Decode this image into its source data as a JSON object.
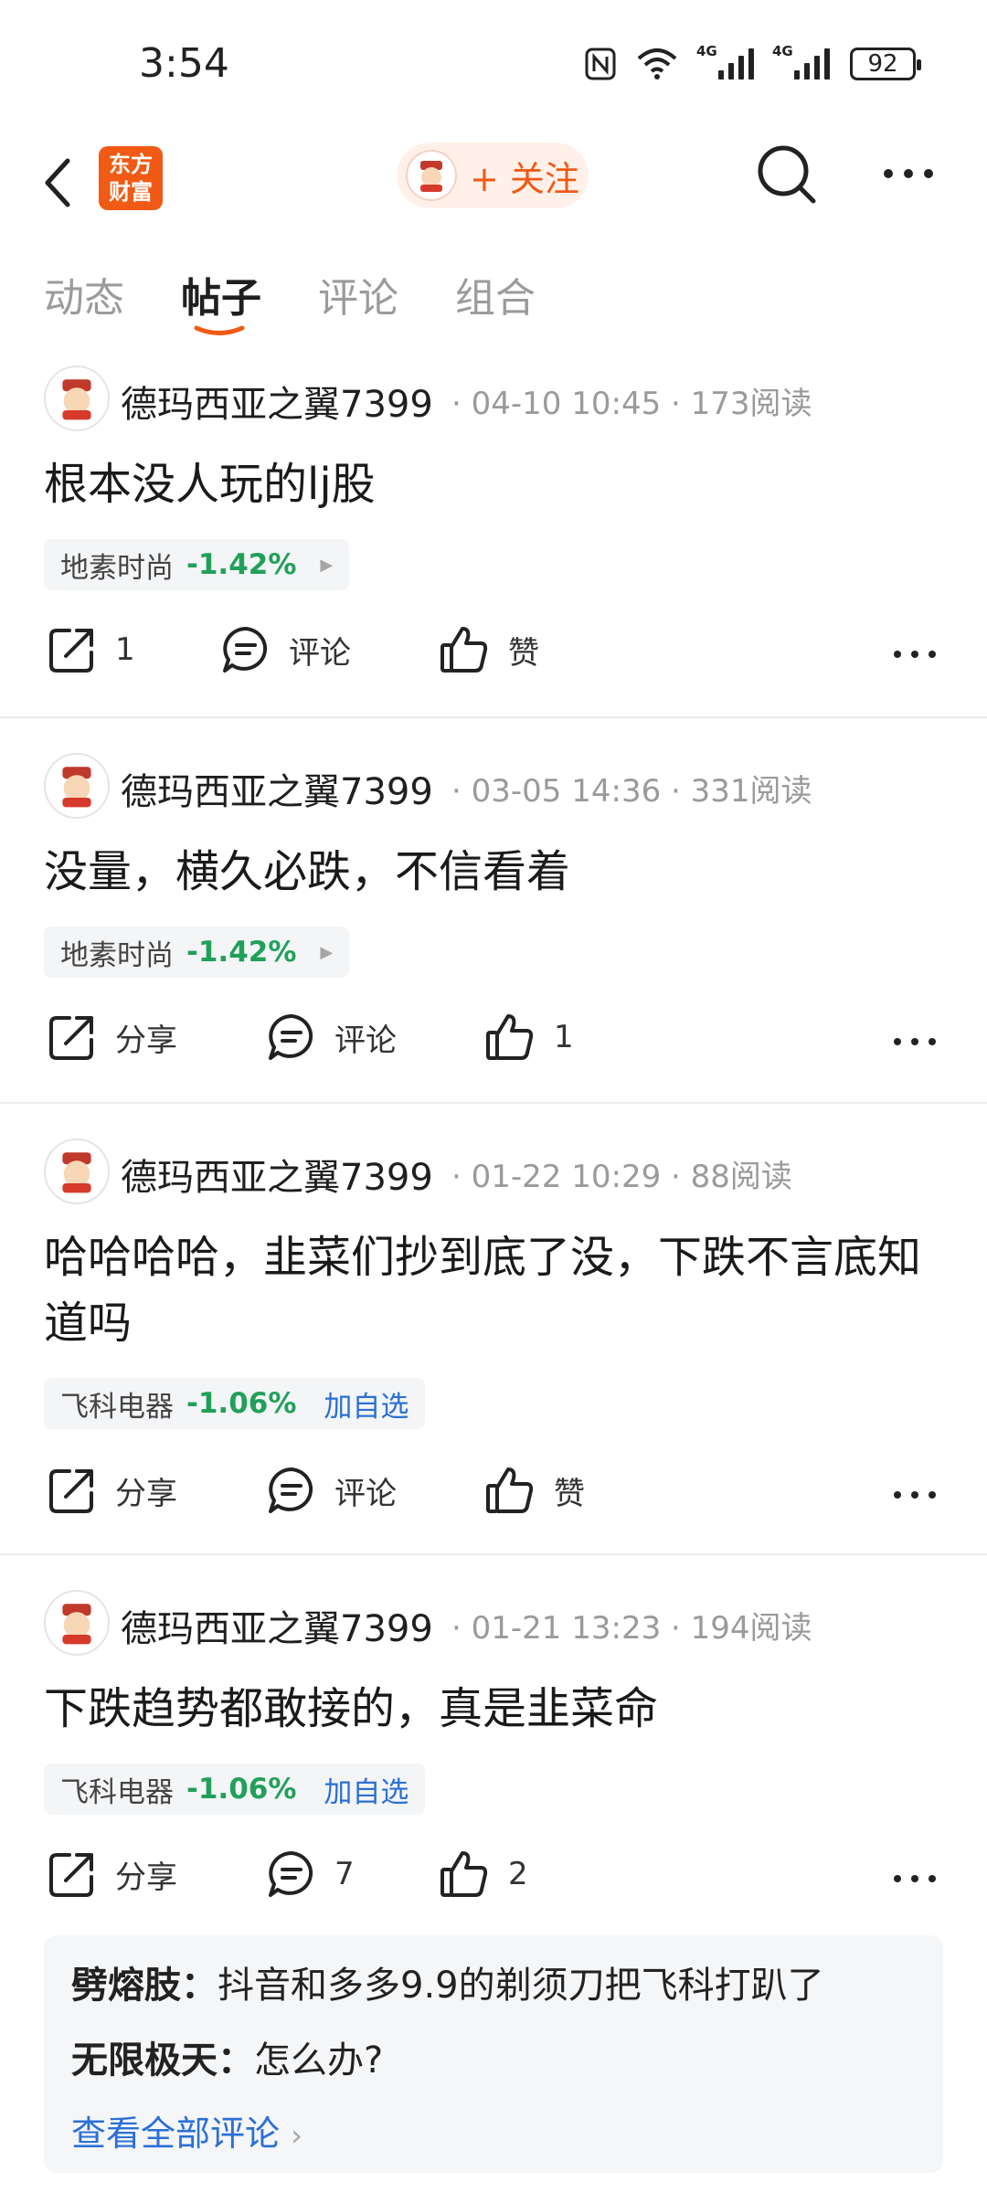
{
  "status_bar": {
    "time": "3:54",
    "battery": "92",
    "net1": "4G",
    "net2": "4G"
  },
  "header": {
    "logo_line1": "东方",
    "logo_line2": "财富",
    "follow_label": "+ 关注"
  },
  "tabs": [
    "动态",
    "帖子",
    "评论",
    "组合"
  ],
  "posts": [
    {
      "author": "德玛西亚之翼7399",
      "time": "04-10 10:45",
      "reads": "173阅读",
      "text": "根本没人玩的lj股",
      "stock": {
        "name": "地素时尚",
        "change": "-1.42%"
      },
      "share": "1",
      "comment": "评论",
      "like": "赞"
    },
    {
      "author": "德玛西亚之翼7399",
      "time": "03-05 14:36",
      "reads": "331阅读",
      "text": "没量，横久必跌，不信看着",
      "stock": {
        "name": "地素时尚",
        "change": "-1.42%"
      },
      "share": "分享",
      "comment": "评论",
      "like": "1"
    },
    {
      "author": "德玛西亚之翼7399",
      "time": "01-22 10:29",
      "reads": "88阅读",
      "text": "哈哈哈哈，韭菜们抄到底了没，下跌不言底知道吗",
      "stock": {
        "name": "飞科电器",
        "change": "-1.06%",
        "add": "加自选"
      },
      "share": "分享",
      "comment": "评论",
      "like": "赞"
    },
    {
      "author": "德玛西亚之翼7399",
      "time": "01-21 13:23",
      "reads": "194阅读",
      "text": "下跌趋势都敢接的，真是韭菜命",
      "stock": {
        "name": "飞科电器",
        "change": "-1.06%",
        "add": "加自选"
      },
      "share": "分享",
      "comment": "7",
      "like": "2"
    }
  ],
  "comments": [
    {
      "user": "劈熔肢：",
      "text": "抖音和多多9.9的剃须刀把飞科打趴了"
    },
    {
      "user": "无限极天：",
      "text": "怎么办?"
    }
  ],
  "view_all": "查看全部评论",
  "colors": {
    "accent": "#f05a14",
    "down": "#21a05a",
    "link": "#2b6fd6"
  }
}
